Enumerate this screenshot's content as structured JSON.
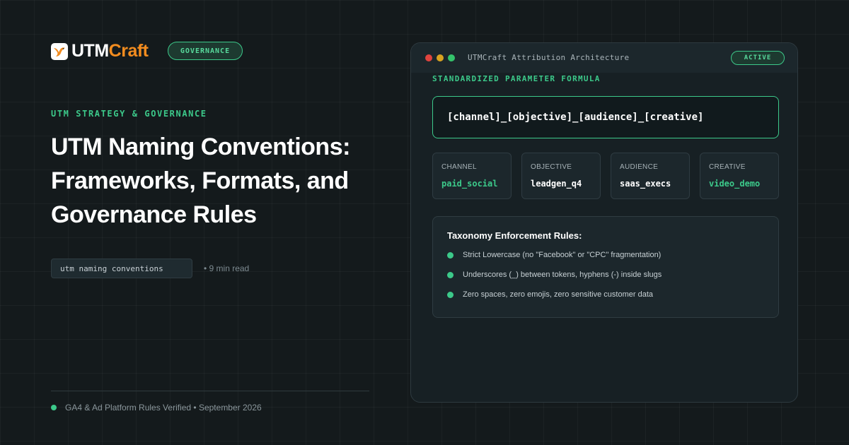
{
  "brand": {
    "name_white": "UTM",
    "name_orange": "Craft",
    "logo_icon": "bird-logo-icon"
  },
  "header": {
    "category_pill": "GOVERNANCE"
  },
  "article": {
    "eyebrow": "UTM STRATEGY & GOVERNANCE",
    "title_lines": [
      "UTM Naming Conventions:",
      "Frameworks, Formats, and",
      "Governance Rules"
    ],
    "keyword_tag": "utm naming conventions",
    "read_time": "• 9 min read",
    "footer_text": "GA4 & Ad Platform Rules Verified • September 2026"
  },
  "panel": {
    "window_title": "UTMCraft Attribution Architecture",
    "status_pill": "ACTIVE",
    "section_label": "STANDARDIZED PARAMETER FORMULA",
    "formula": "[channel]_[objective]_[audience]_[creative]",
    "tokens": [
      {
        "label": "CHANNEL",
        "value": "paid_social",
        "value_color": "#3cc98a"
      },
      {
        "label": "OBJECTIVE",
        "value": "leadgen_q4",
        "value_color": "#ffffff"
      },
      {
        "label": "AUDIENCE",
        "value": "saas_execs",
        "value_color": "#ffffff"
      },
      {
        "label": "CREATIVE",
        "value": "video_demo",
        "value_color": "#3cc98a"
      }
    ],
    "rules_title": "Taxonomy Enforcement Rules:",
    "rules": [
      "Strict Lowercase (no \"Facebook\" or \"CPC\" fragmentation)",
      "Underscores (_) between tokens, hyphens (-) inside slugs",
      "Zero spaces, zero emojis, zero sensitive customer data"
    ]
  },
  "colors": {
    "background": "#141a1c",
    "accent_green": "#3cc98a",
    "brand_orange": "#f28c1f",
    "traffic_red": "#e0443e",
    "traffic_yellow": "#d9a320",
    "traffic_green": "#34c36b"
  }
}
